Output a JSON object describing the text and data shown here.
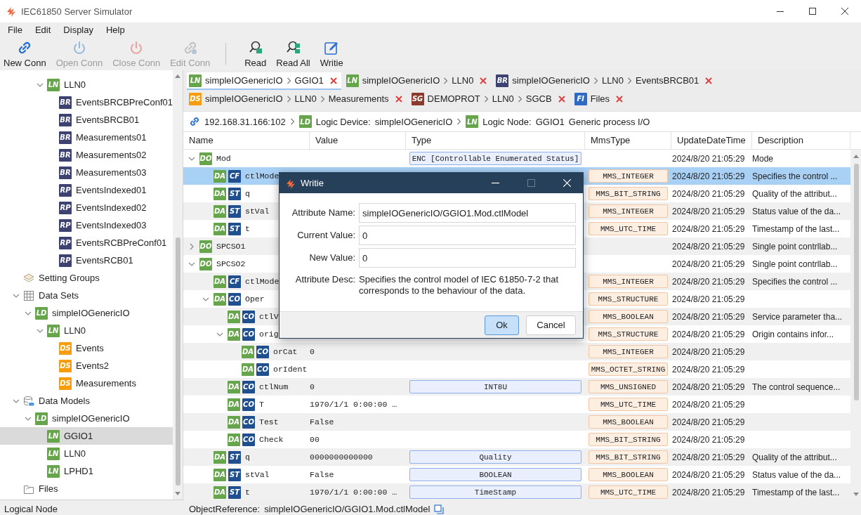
{
  "window": {
    "title": "IEC61850 Server Simulator"
  },
  "menu": [
    "File",
    "Edit",
    "Display",
    "Help"
  ],
  "toolbar": [
    {
      "kind": "connect",
      "label": "New Conn",
      "disabled": false
    },
    {
      "kind": "open",
      "label": "Open Conn",
      "disabled": true
    },
    {
      "kind": "close",
      "label": "Close Conn",
      "disabled": true
    },
    {
      "kind": "edit",
      "label": "Edit Conn",
      "disabled": true
    },
    {
      "kind": "separator"
    },
    {
      "kind": "read",
      "label": "Read",
      "disabled": false
    },
    {
      "kind": "read-all",
      "label": "Read All",
      "disabled": false
    },
    {
      "kind": "write",
      "label": "Writie",
      "disabled": false
    }
  ],
  "tree": [
    {
      "children": [
        {
          "children": [
            {
              "children": [
                {
                  "label": "LLN0",
                  "badge": {
                    "text": "LN",
                    "color": "#67a54d"
                  },
                  "expanded": true,
                  "selected": false,
                  "children": [
                    {
                      "label": "EventsBRCBPreConf01",
                      "badge": {
                        "text": "BR",
                        "color": "#3d4270"
                      },
                      "selected": false
                    },
                    {
                      "label": "EventsBRCB01",
                      "badge": {
                        "text": "BR",
                        "color": "#3d4270"
                      },
                      "selected": false
                    },
                    {
                      "label": "Measurements01",
                      "badge": {
                        "text": "BR",
                        "color": "#3d4270"
                      },
                      "selected": false
                    },
                    {
                      "label": "Measurements02",
                      "badge": {
                        "text": "BR",
                        "color": "#3d4270"
                      },
                      "selected": false
                    },
                    {
                      "label": "Measurements03",
                      "badge": {
                        "text": "BR",
                        "color": "#3d4270"
                      },
                      "selected": false
                    },
                    {
                      "label": "EventsIndexed01",
                      "badge": {
                        "text": "RP",
                        "color": "#3d4270"
                      },
                      "selected": false
                    },
                    {
                      "label": "EventsIndexed02",
                      "badge": {
                        "text": "RP",
                        "color": "#3d4270"
                      },
                      "selected": false
                    },
                    {
                      "label": "EventsIndexed03",
                      "badge": {
                        "text": "RP",
                        "color": "#3d4270"
                      },
                      "selected": false
                    },
                    {
                      "label": "EventsRCBPreConf01",
                      "badge": {
                        "text": "RP",
                        "color": "#3d4270"
                      },
                      "selected": false
                    },
                    {
                      "label": "EventsRCB01",
                      "badge": {
                        "text": "RP",
                        "color": "#3d4270"
                      },
                      "selected": false
                    }
                  ]
                }
              ]
            }
          ]
        },
        {
          "label": "Setting Groups",
          "kind": "setting-groups",
          "selected": false
        },
        {
          "label": "Data Sets",
          "kind": "data-sets",
          "expanded": true,
          "selected": false,
          "children": [
            {
              "label": "simpleIOGenericIO",
              "badge": {
                "text": "LD",
                "color": "#67a54d"
              },
              "expanded": true,
              "selected": false,
              "children": [
                {
                  "label": "LLN0",
                  "badge": {
                    "text": "LN",
                    "color": "#67a54d"
                  },
                  "expanded": true,
                  "selected": false,
                  "children": [
                    {
                      "label": "Events",
                      "badge": {
                        "text": "DS",
                        "color": "#f59d0e"
                      },
                      "selected": false
                    },
                    {
                      "label": "Events2",
                      "badge": {
                        "text": "DS",
                        "color": "#f59d0e"
                      },
                      "selected": false
                    },
                    {
                      "label": "Measurements",
                      "badge": {
                        "text": "DS",
                        "color": "#f59d0e"
                      },
                      "selected": false
                    }
                  ]
                }
              ]
            }
          ]
        },
        {
          "label": "Data Models",
          "kind": "data-models",
          "expanded": true,
          "selected": false,
          "children": [
            {
              "label": "simpleIOGenericIO",
              "badge": {
                "text": "LD",
                "color": "#67a54d"
              },
              "expanded": true,
              "selected": false,
              "children": [
                {
                  "label": "GGIO1",
                  "badge": {
                    "text": "LN",
                    "color": "#67a54d"
                  },
                  "selected": true
                },
                {
                  "label": "LLN0",
                  "badge": {
                    "text": "LN",
                    "color": "#67a54d"
                  },
                  "selected": false
                },
                {
                  "label": "LPHD1",
                  "badge": {
                    "text": "LN",
                    "color": "#67a54d"
                  },
                  "selected": false
                }
              ]
            }
          ]
        },
        {
          "label": "Files",
          "kind": "files",
          "selected": false
        }
      ]
    }
  ],
  "tabs": [
    {
      "badge": {
        "text": "LN",
        "color": "#67a54d"
      },
      "path": [
        "simpleIOGenericIO",
        "GGIO1"
      ],
      "selected": true
    },
    {
      "badge": {
        "text": "LN",
        "color": "#67a54d"
      },
      "path": [
        "simpleIOGenericIO",
        "LLN0"
      ],
      "selected": false
    },
    {
      "badge": {
        "text": "BR",
        "color": "#3d4270"
      },
      "path": [
        "simpleIOGenericIO",
        "LLN0",
        "EventsBRCB01"
      ],
      "selected": false
    },
    {
      "badge": {
        "text": "DS",
        "color": "#f59d0e"
      },
      "path": [
        "simpleIOGenericIO",
        "LLN0",
        "Measurements"
      ],
      "selected": false
    },
    {
      "badge": {
        "text": "SG",
        "color": "#8b3b2c"
      },
      "path": [
        "DEMOPROT",
        "LLN0",
        "SGCB"
      ],
      "selected": false
    },
    {
      "badge": {
        "text": "FI",
        "color": "#2f6bc2"
      },
      "path": [
        "Files"
      ],
      "selected": false
    }
  ],
  "breadcrumb": {
    "address": "192.168.31.166:102",
    "device": {
      "badge": {
        "text": "LD",
        "color": "#67a54d"
      },
      "label": "Logic Device:",
      "value": "simpleIOGenericIO"
    },
    "node": {
      "badge": {
        "text": "LN",
        "color": "#67a54d"
      },
      "label": "Logic Node:",
      "value": "GGIO1",
      "description": "Generic process I/O"
    }
  },
  "table": {
    "columns": [
      "Name",
      "Value",
      "Type",
      "MmsType",
      "UpdateDateTime",
      "Description"
    ],
    "rows": [
      {
        "name": "Mod",
        "badges": [
          {
            "text": "DO",
            "color": "#67a54d"
          }
        ],
        "expanded": true,
        "selected": false,
        "type": "ENC [Controllable Enumerated Status]",
        "updated": "2024/8/20 21:05:29",
        "description": "Mode",
        "children": [
          {
            "name": "ctlMode",
            "badges": [
              {
                "text": "DA",
                "color": "#67a54d"
              },
              {
                "text": "CF",
                "color": "#1f4f8f"
              }
            ],
            "selected": true,
            "mms_type": "MMS_INTEGER",
            "updated": "2024/8/20 21:05:29",
            "description": "Specifies the control ..."
          },
          {
            "name": "q",
            "badges": [
              {
                "text": "DA",
                "color": "#67a54d"
              },
              {
                "text": "ST",
                "color": "#1f4f8f"
              }
            ],
            "selected": false,
            "mms_type": "MMS_BIT_STRING",
            "updated": "2024/8/20 21:05:29",
            "description": "Quality of the attribut..."
          },
          {
            "name": "stVal",
            "badges": [
              {
                "text": "DA",
                "color": "#67a54d"
              },
              {
                "text": "ST",
                "color": "#1f4f8f"
              }
            ],
            "selected": false,
            "mms_type": "MMS_INTEGER",
            "updated": "2024/8/20 21:05:29",
            "description": "Status value of the da..."
          },
          {
            "name": "t",
            "badges": [
              {
                "text": "DA",
                "color": "#67a54d"
              },
              {
                "text": "ST",
                "color": "#1f4f8f"
              }
            ],
            "selected": false,
            "mms_type": "MMS_UTC_TIME",
            "updated": "2024/8/20 21:05:29",
            "description": "Timestamp of the last..."
          }
        ]
      },
      {
        "name": "SPCSO1",
        "badges": [
          {
            "text": "DO",
            "color": "#67a54d"
          }
        ],
        "expanded": false,
        "selected": false,
        "updated": "2024/8/20 21:05:29",
        "description": "Single point contrllab..."
      },
      {
        "name": "SPCSO2",
        "badges": [
          {
            "text": "DO",
            "color": "#67a54d"
          }
        ],
        "expanded": true,
        "selected": false,
        "updated": "2024/8/20 21:05:29",
        "description": "Single point contrllab...",
        "children": [
          {
            "name": "ctlMode",
            "badges": [
              {
                "text": "DA",
                "color": "#67a54d"
              },
              {
                "text": "CF",
                "color": "#1f4f8f"
              }
            ],
            "selected": false,
            "mms_type": "MMS_INTEGER",
            "updated": "2024/8/20 21:05:29",
            "description": "Specifies the control ..."
          },
          {
            "name": "Oper",
            "badges": [
              {
                "text": "DA",
                "color": "#67a54d"
              },
              {
                "text": "CO",
                "color": "#1f4f8f"
              }
            ],
            "expanded": true,
            "selected": false,
            "mms_type": "MMS_STRUCTURE",
            "updated": "2024/8/20 21:05:29",
            "children": [
              {
                "name": "ctlV",
                "badges": [
                  {
                    "text": "DA",
                    "color": "#67a54d"
                  },
                  {
                    "text": "CO",
                    "color": "#1f4f8f"
                  }
                ],
                "selected": false,
                "mms_type": "MMS_BOOLEAN",
                "updated": "2024/8/20 21:05:29",
                "description": "Service parameter tha..."
              },
              {
                "name": "orig",
                "badges": [
                  {
                    "text": "DA",
                    "color": "#67a54d"
                  },
                  {
                    "text": "CO",
                    "color": "#1f4f8f"
                  }
                ],
                "expanded": true,
                "selected": false,
                "mms_type": "MMS_STRUCTURE",
                "updated": "2024/8/20 21:05:29",
                "description": "Origin contains infor...",
                "children": [
                  {
                    "name": "orCat",
                    "badges": [
                      {
                        "text": "DA",
                        "color": "#67a54d"
                      },
                      {
                        "text": "CO",
                        "color": "#1f4f8f"
                      }
                    ],
                    "selected": false,
                    "value": "0",
                    "mms_type": "MMS_INTEGER",
                    "updated": "2024/8/20 21:05:29"
                  },
                  {
                    "name": "orIdent",
                    "badges": [
                      {
                        "text": "DA",
                        "color": "#67a54d"
                      },
                      {
                        "text": "CO",
                        "color": "#1f4f8f"
                      }
                    ],
                    "selected": false,
                    "mms_type": "MMS_OCTET_STRING",
                    "updated": "2024/8/20 21:05:29"
                  }
                ]
              },
              {
                "name": "ctlNum",
                "badges": [
                  {
                    "text": "DA",
                    "color": "#67a54d"
                  },
                  {
                    "text": "CO",
                    "color": "#1f4f8f"
                  }
                ],
                "selected": false,
                "value": "0",
                "type": "INT8U",
                "mms_type": "MMS_UNSIGNED",
                "updated": "2024/8/20 21:05:29",
                "description": "The control sequence..."
              },
              {
                "name": "T",
                "badges": [
                  {
                    "text": "DA",
                    "color": "#67a54d"
                  },
                  {
                    "text": "CO",
                    "color": "#1f4f8f"
                  }
                ],
                "selected": false,
                "value": "1970/1/1 0:00:00 …",
                "mms_type": "MMS_UTC_TIME",
                "updated": "2024/8/20 21:05:29"
              },
              {
                "name": "Test",
                "badges": [
                  {
                    "text": "DA",
                    "color": "#67a54d"
                  },
                  {
                    "text": "CO",
                    "color": "#1f4f8f"
                  }
                ],
                "selected": false,
                "value": "False",
                "mms_type": "MMS_BOOLEAN",
                "updated": "2024/8/20 21:05:29"
              },
              {
                "name": "Check",
                "badges": [
                  {
                    "text": "DA",
                    "color": "#67a54d"
                  },
                  {
                    "text": "CO",
                    "color": "#1f4f8f"
                  }
                ],
                "selected": false,
                "value": "00",
                "mms_type": "MMS_BIT_STRING",
                "updated": "2024/8/20 21:05:29"
              }
            ]
          },
          {
            "name": "q",
            "badges": [
              {
                "text": "DA",
                "color": "#67a54d"
              },
              {
                "text": "ST",
                "color": "#1f4f8f"
              }
            ],
            "selected": false,
            "value": "0000000000000",
            "type": "Quality",
            "mms_type": "MMS_BIT_STRING",
            "updated": "2024/8/20 21:05:29",
            "description": "Quality of the attribut..."
          },
          {
            "name": "stVal",
            "badges": [
              {
                "text": "DA",
                "color": "#67a54d"
              },
              {
                "text": "ST",
                "color": "#1f4f8f"
              }
            ],
            "selected": false,
            "value": "False",
            "type": "BOOLEAN",
            "mms_type": "MMS_BOOLEAN",
            "updated": "2024/8/20 21:05:29",
            "description": "Status value of the da..."
          },
          {
            "name": "t",
            "badges": [
              {
                "text": "DA",
                "color": "#67a54d"
              },
              {
                "text": "ST",
                "color": "#1f4f8f"
              }
            ],
            "selected": false,
            "value": "1970/1/1 0:00:00 …",
            "type": "TimeStamp",
            "mms_type": "MMS_UTC_TIME",
            "updated": "2024/8/20 21:05:29",
            "description": "Timestamp of the last..."
          }
        ]
      }
    ]
  },
  "dialog": {
    "title": "Writie",
    "fields": [
      {
        "label": "Attribute Name:",
        "value": "simpleIOGenericIO/GGIO1.Mod.ctlModel"
      },
      {
        "label": "Current Value:",
        "value": "0"
      },
      {
        "label": "New Value:",
        "value": "0"
      }
    ],
    "description": {
      "label": "Attribute Desc:",
      "text": "Specifies the control model of IEC 61850-7-2 that corresponds to the behaviour of the data."
    },
    "buttons": [
      {
        "label": "Ok",
        "default": true
      },
      {
        "label": "Cancel",
        "default": false
      }
    ]
  },
  "status_bar": {
    "context": "Logical Node",
    "label": "ObjectReference:",
    "value": "simpleIOGenericIO/GGIO1.Mod.ctlModel"
  }
}
